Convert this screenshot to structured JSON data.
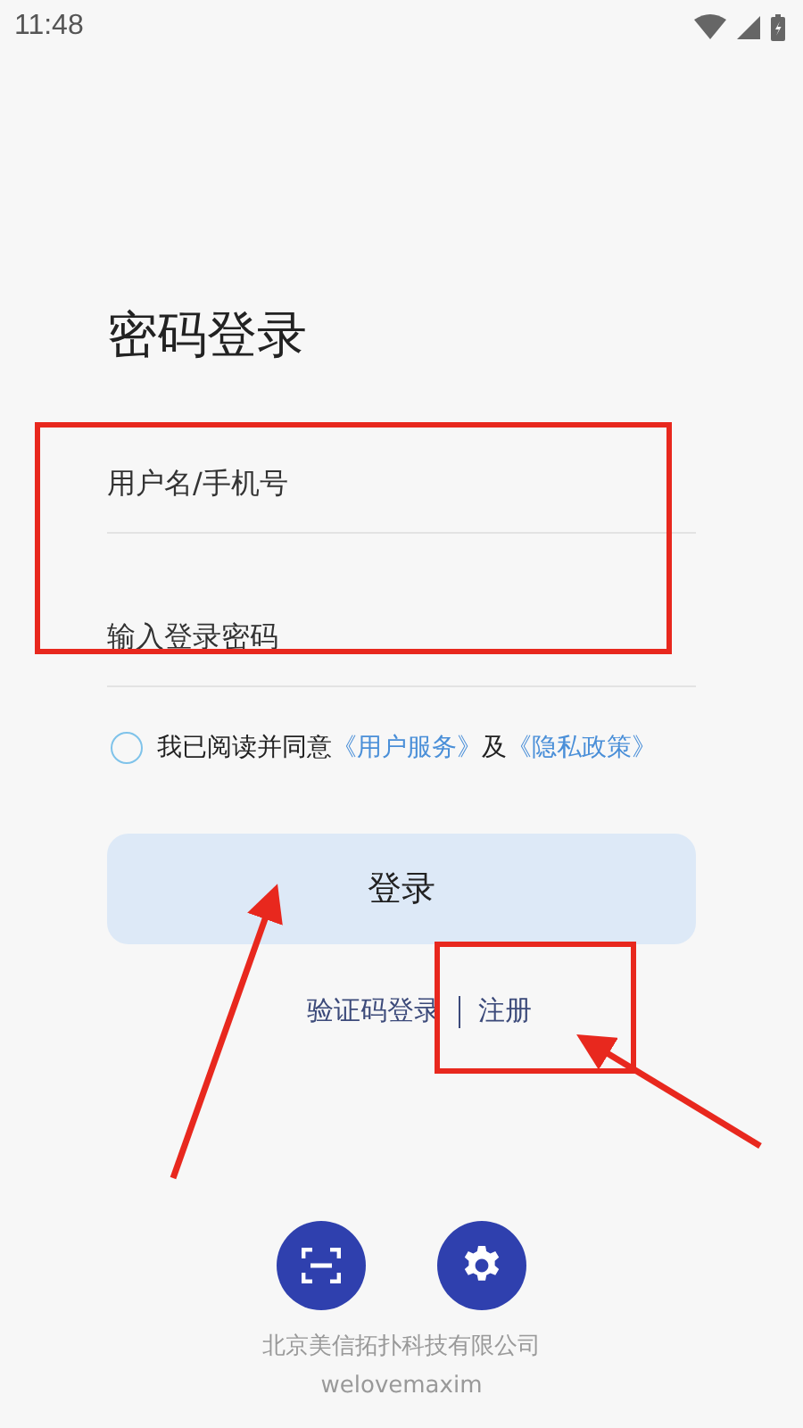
{
  "status_bar": {
    "time": "11:48"
  },
  "title": "密码登录",
  "fields": [
    {
      "placeholder": "用户名/手机号"
    },
    {
      "placeholder": "输入登录密码"
    }
  ],
  "agreement": {
    "checked": false,
    "parts": [
      {
        "kind": "text",
        "text": "我已阅读并同意"
      },
      {
        "kind": "link",
        "text": "《用户服务》"
      },
      {
        "kind": "text",
        "text": "及"
      },
      {
        "kind": "link",
        "text": "《隐私政策》"
      }
    ]
  },
  "login_button": "登录",
  "links": [
    "验证码登录",
    "注册"
  ],
  "footer": {
    "company": "北京美信拓扑科技有限公司",
    "website": "welovemaxim"
  }
}
